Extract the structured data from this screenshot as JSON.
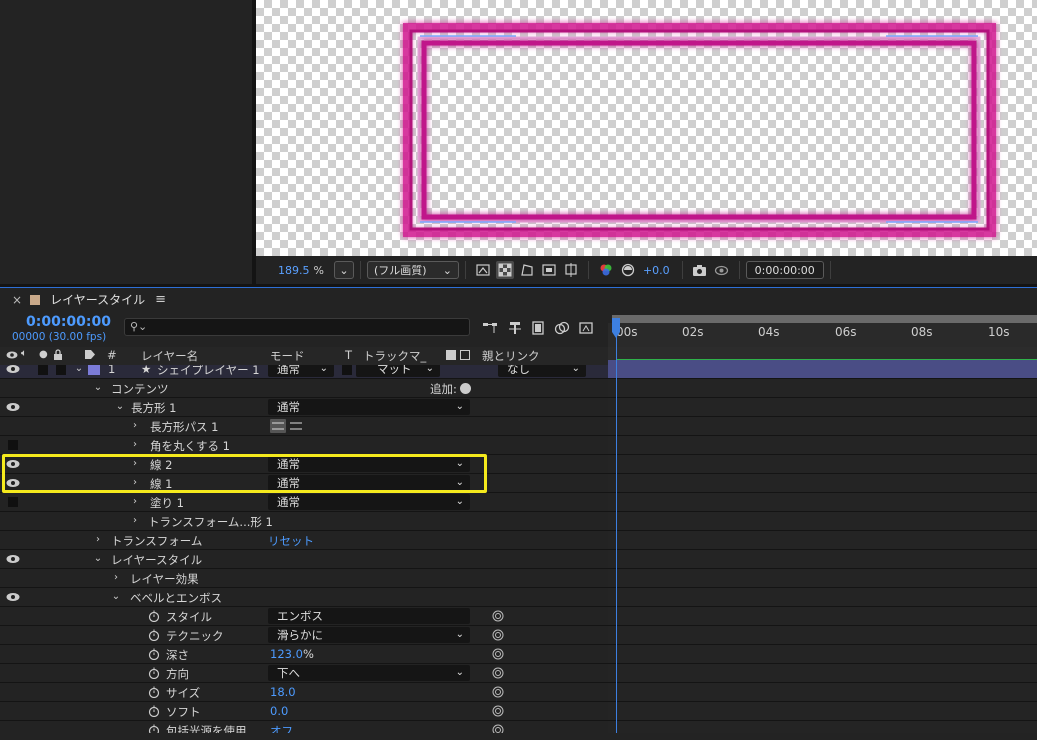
{
  "viewer_toolbar": {
    "zoom": "189.5",
    "zoom_unit": "%",
    "quality": "(フル画質)",
    "exposure": "+0.0",
    "timecode": "0:00:00:00"
  },
  "timeline": {
    "tab_title": "レイヤースタイル",
    "current_time": "0:00:00:00",
    "current_frame": "00000 (30.00 fps)",
    "search_placeholder": "",
    "columns": {
      "hash": "#",
      "layer_name": "レイヤー名",
      "mode": "モード",
      "t": "T",
      "track_matte": "トラックマ_",
      "parent_link": "親とリンク"
    },
    "ruler_ticks": [
      "00s",
      "02s",
      "04s",
      "06s",
      "08s",
      "10s"
    ],
    "layer": {
      "number": "1",
      "name": "シェイプレイヤー 1",
      "mode": "通常",
      "matte": "マット",
      "parent": "なし",
      "label_color": "#7b7bd8"
    },
    "rows": {
      "contents": "コンテンツ",
      "add_label": "追加:",
      "rectangle": "長方形 1",
      "rectangle_mode": "通常",
      "rect_path": "長方形パス 1",
      "round_corners": "角を丸くする 1",
      "stroke2": "線 2",
      "stroke2_mode": "通常",
      "stroke1": "線 1",
      "stroke1_mode": "通常",
      "fill1": "塗り 1",
      "fill1_mode": "通常",
      "transform_shape": "トランスフォーム...形 1",
      "transform": "トランスフォーム",
      "reset": "リセット",
      "layer_styles": "レイヤースタイル",
      "layer_effect": "レイヤー効果",
      "bevel_emboss": "ベベルとエンボス",
      "style_label": "スタイル",
      "style_value": "エンボス",
      "technique_label": "テクニック",
      "technique_value": "滑らかに",
      "depth_label": "深さ",
      "depth_value": "123.0",
      "depth_unit": "%",
      "direction_label": "方向",
      "direction_value": "下へ",
      "size_label": "サイズ",
      "size_value": "18.0",
      "soften_label": "ソフト",
      "soften_value": "0.0",
      "global_light_label": "包括光源を使用",
      "global_light_value": "オフ"
    }
  },
  "colors": {
    "accent": "#4d9bff",
    "highlight": "#f5ea1d",
    "neon": "#e0109a"
  }
}
